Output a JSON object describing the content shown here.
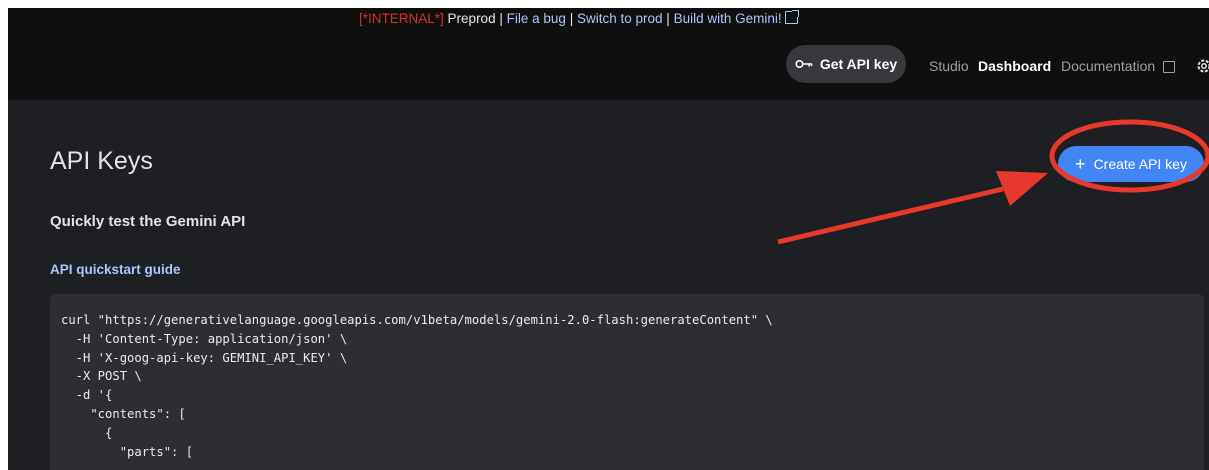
{
  "banner": {
    "internal": "[*INTERNAL*]",
    "preprod": "Preprod",
    "sep": "|",
    "file_bug": "File a bug",
    "switch": "Switch to prod",
    "build": "Build with Gemini!"
  },
  "header": {
    "get_key_label": "Get API key",
    "nav": {
      "studio": "Studio",
      "dashboard": "Dashboard",
      "documentation": "Documentation"
    }
  },
  "main": {
    "title": "API Keys",
    "create_label": "Create API key",
    "create_plus": "+",
    "subtitle": "Quickly test the Gemini API",
    "quickstart": "API quickstart guide",
    "code": [
      "curl \"https://generativelanguage.googleapis.com/v1beta/models/gemini-2.0-flash:generateContent\" \\",
      "  -H 'Content-Type: application/json' \\",
      "  -H 'X-goog-api-key: GEMINI_API_KEY' \\",
      "  -X POST \\",
      "  -d '{",
      "    \"contents\": [",
      "      {",
      "        \"parts\": ["
    ]
  },
  "colors": {
    "background": "#1e1f22",
    "topbar": "#0f0f10",
    "accent": "#4285f4",
    "link": "#a8c7fa",
    "annotation": "#e8372b",
    "internal_tag": "#d93025"
  },
  "icons": {
    "get_key": "key-icon",
    "docs": "external-link-icon",
    "settings": "gear-icon"
  }
}
